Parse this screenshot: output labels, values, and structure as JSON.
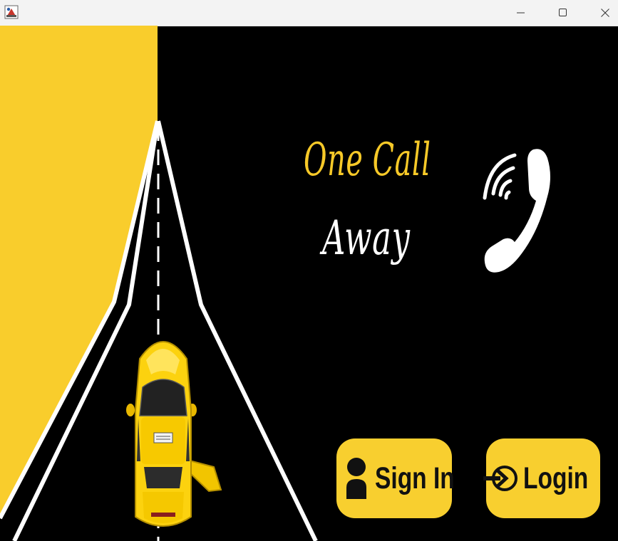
{
  "window": {
    "app_icon": "java-app-icon",
    "controls": [
      "minimize-icon",
      "maximize-icon",
      "close-icon"
    ]
  },
  "headline": {
    "line1": "One Call",
    "line2": "Away"
  },
  "actions": {
    "signin_label": "Sign In",
    "login_label": "Login"
  },
  "colors": {
    "accent_yellow": "#f8cf2f",
    "background": "#000000",
    "text_light": "#ffffff"
  },
  "icons": {
    "phone": "phone-icon",
    "signin": "user-icon",
    "login": "login-icon",
    "taxi": "taxi-car-illustration"
  }
}
